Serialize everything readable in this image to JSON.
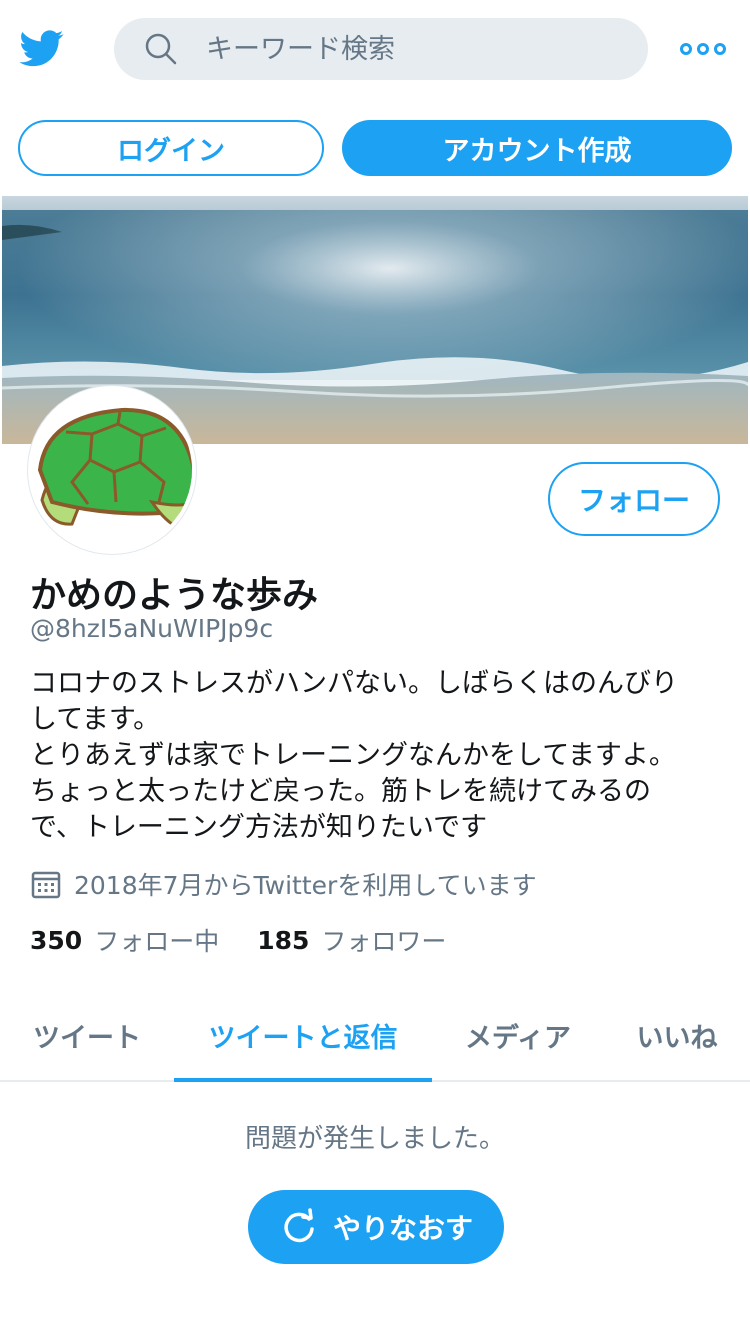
{
  "header": {
    "logo_icon": "twitter-bird-icon",
    "search_placeholder": "キーワード検索",
    "more_icon": "more-dots-icon"
  },
  "auth": {
    "login_label": "ログイン",
    "signup_label": "アカウント作成"
  },
  "profile": {
    "display_name": "かめのような歩み",
    "handle": "@8hzI5aNuWIPJp9c",
    "bio": "コロナのストレスがハンパない。しばらくはのんびり\nしてます。\nとりあえずは家でトレーニングなんかをしてますよ。\nちょっと太ったけど戻った。筋トレを続けてみるの\nで、トレーニング方法が知りたいです",
    "joined": "2018年7月からTwitterを利用しています",
    "follow_label": "フォロー",
    "following_count": "350",
    "following_label": "フォロー中",
    "followers_count": "185",
    "followers_label": "フォロワー"
  },
  "tabs": [
    {
      "label": "ツイート",
      "active": false
    },
    {
      "label": "ツイートと返信",
      "active": true
    },
    {
      "label": "メディア",
      "active": false
    },
    {
      "label": "いいね",
      "active": false
    }
  ],
  "timeline": {
    "error_message": "問題が発生しました。",
    "retry_label": "やりなおす"
  },
  "colors": {
    "accent": "#1da1f2",
    "text_primary": "#14171a",
    "text_secondary": "#657786",
    "search_bg": "#e6ecf0"
  }
}
